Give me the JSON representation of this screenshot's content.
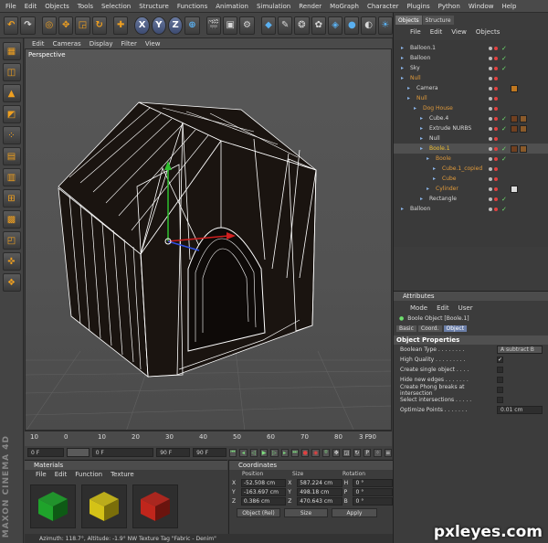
{
  "menubar": [
    "File",
    "Edit",
    "Objects",
    "Tools",
    "Selection",
    "Structure",
    "Functions",
    "Animation",
    "Simulation",
    "Render",
    "MoGraph",
    "Character",
    "Plugins",
    "Python",
    "Window",
    "Help"
  ],
  "viewport": {
    "menu": [
      "Edit",
      "Cameras",
      "Display",
      "Filter",
      "View"
    ],
    "label": "Perspective"
  },
  "timeline": {
    "ticks": [
      "10",
      "0",
      "10",
      "20",
      "30",
      "40",
      "50",
      "60",
      "70",
      "80",
      "90"
    ],
    "frame_end": "3 F",
    "start_field": "0 F",
    "current_field": "0 F",
    "preview_end_field": "90 F",
    "end_field": "90 F"
  },
  "materials": {
    "title": "Materials",
    "menu": [
      "File",
      "Edit",
      "Function",
      "Texture"
    ],
    "swatches": [
      {
        "color": "#1fa32b",
        "dark": "#0e5a15"
      },
      {
        "color": "#d4c217",
        "dark": "#7a6e0a"
      },
      {
        "color": "#c0261c",
        "dark": "#6a140e"
      }
    ]
  },
  "coordinates": {
    "title": "Coordinates",
    "headers": [
      "Position",
      "Size",
      "Rotation"
    ],
    "rows": [
      {
        "axis": "X",
        "position": "-52.508 cm",
        "size_axis": "X",
        "size": "587.224 cm",
        "rot_axis": "H",
        "rotation": "0 °"
      },
      {
        "axis": "Y",
        "position": "-163.697 cm",
        "size_axis": "Y",
        "size": "498.18 cm",
        "rot_axis": "P",
        "rotation": "0 °"
      },
      {
        "axis": "Z",
        "position": "0.386 cm",
        "size_axis": "Z",
        "size": "470.643 cm",
        "rot_axis": "B",
        "rotation": "0 °"
      }
    ],
    "mode_select": "Object (Rel)",
    "size_select": "Size",
    "apply_label": "Apply"
  },
  "statusbar": "Azimuth: 118.7°, Altitude: -1.9°  NW   Texture Tag \"Fabric - Denim\"",
  "brand": "MAXON CINEMA 4D",
  "objects_panel": {
    "tabs": [
      "Objects",
      "Structure"
    ],
    "menu": [
      "File",
      "Edit",
      "View",
      "Objects"
    ],
    "items": [
      {
        "name": "Balloon.1",
        "indent": 0,
        "color": "#d8d8d8",
        "check": "✓",
        "tags": []
      },
      {
        "name": "Balloon",
        "indent": 0,
        "color": "#d8d8d8",
        "check": "✓",
        "tags": []
      },
      {
        "name": "Sky",
        "indent": 0,
        "color": "#d8d8d8",
        "check": "✓",
        "tags": []
      },
      {
        "name": "Null",
        "indent": 0,
        "color": "#e09a3a",
        "check": "",
        "tags": []
      },
      {
        "name": "Camera",
        "indent": 1,
        "color": "#d8d8d8",
        "check": "",
        "tags": [
          "#c07820"
        ]
      },
      {
        "name": "Null",
        "indent": 1,
        "color": "#e09a3a",
        "check": "",
        "tags": []
      },
      {
        "name": "Dog House",
        "indent": 2,
        "color": "#e09a3a",
        "check": "",
        "tags": []
      },
      {
        "name": "Cube.4",
        "indent": 3,
        "color": "#d8d8d8",
        "check": "✓",
        "tags": [
          "#704020",
          "#8a5a2a"
        ]
      },
      {
        "name": "Extrude NURBS",
        "indent": 3,
        "color": "#d8d8d8",
        "check": "✓",
        "tags": [
          "#704020",
          "#8a5a2a"
        ]
      },
      {
        "name": "Null",
        "indent": 3,
        "color": "#d8d8d8",
        "check": "",
        "tags": []
      },
      {
        "name": "Boole.1",
        "indent": 3,
        "color": "#f0c030",
        "check": "✓",
        "tags": [
          "#704020",
          "#8a5a2a"
        ]
      },
      {
        "name": "Boole",
        "indent": 4,
        "color": "#e09a3a",
        "check": "✓",
        "tags": []
      },
      {
        "name": "Cube.1_copied",
        "indent": 5,
        "color": "#e09a3a",
        "check": "",
        "tags": []
      },
      {
        "name": "Cube",
        "indent": 5,
        "color": "#e09a3a",
        "check": "",
        "tags": []
      },
      {
        "name": "Cylinder",
        "indent": 4,
        "color": "#e09a3a",
        "check": "",
        "tags": [
          "#dddddd"
        ]
      },
      {
        "name": "Rectangle",
        "indent": 3,
        "color": "#d8d8d8",
        "check": "✓",
        "tags": []
      },
      {
        "name": "Balloon",
        "indent": 0,
        "color": "#d8d8d8",
        "check": "✓",
        "tags": []
      }
    ]
  },
  "attributes": {
    "title": "Attributes",
    "menu": [
      "Mode",
      "Edit",
      "User"
    ],
    "object_title": "Boole Object [Boole.1]",
    "tabs": [
      "Basic",
      "Coord.",
      "Object"
    ],
    "section": "Object Properties",
    "props": [
      {
        "label": "Boolean Type . . . . . . . .",
        "kind": "select",
        "value": "A subtract B"
      },
      {
        "label": "High Quality . . . . . . . . .",
        "kind": "check",
        "value": "✓"
      },
      {
        "label": "Create single object . . . .",
        "kind": "check",
        "value": ""
      },
      {
        "label": "Hide new edges . . . . . . .",
        "kind": "check",
        "value": ""
      },
      {
        "label": "Create Phong breaks at intersection",
        "kind": "check",
        "value": ""
      },
      {
        "label": "Select intersections . . . . .",
        "kind": "check",
        "value": ""
      },
      {
        "label": "Optimize Points . . . . . . .",
        "kind": "field",
        "value": "0.01 cm"
      }
    ]
  },
  "watermark": "pxleyes.com"
}
